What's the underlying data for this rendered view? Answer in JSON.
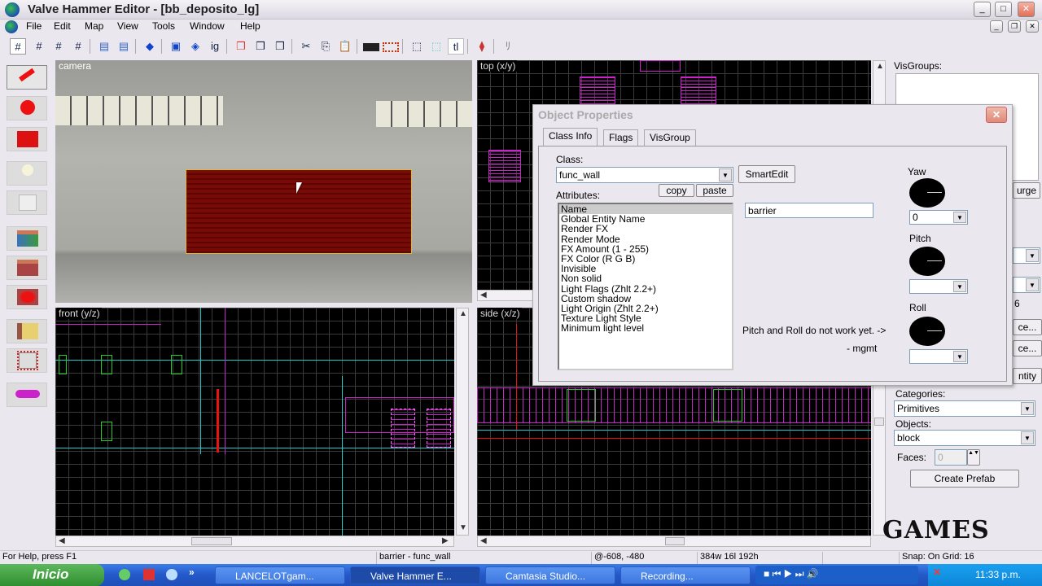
{
  "window": {
    "title": "Valve Hammer Editor - [bb_deposito_lg]",
    "min": "_",
    "max": "□",
    "close": "✕"
  },
  "menu": [
    "File",
    "Edit",
    "Map",
    "View",
    "Tools",
    "Window",
    "Help"
  ],
  "toolbar": {
    "ig_label": "ig",
    "tl_label": "tl"
  },
  "viewports": {
    "camera": "camera",
    "top": "top (x/y)",
    "front": "front (y/z)",
    "side": "side (x/z)"
  },
  "right_panel": {
    "visgroups_label": "VisGroups:",
    "purge_btn": "urge",
    "val6": "6",
    "btn_replace": "ce...",
    "btn_replace2": "ce...",
    "btn_entity": "ntity",
    "categories_label": "Categories:",
    "categories_value": "Primitives",
    "objects_label": "Objects:",
    "objects_value": "block",
    "faces_label": "Faces:",
    "faces_value": "0",
    "create_prefab": "Create Prefab"
  },
  "dialog": {
    "title": "Object Properties",
    "tabs": [
      "Class Info",
      "Flags",
      "VisGroup"
    ],
    "class_label": "Class:",
    "class_value": "func_wall",
    "smartedit": "SmartEdit",
    "attributes_label": "Attributes:",
    "copy": "copy",
    "paste": "paste",
    "attributes": [
      "Name",
      "Global Entity Name",
      "Render FX",
      "Render Mode",
      "FX Amount (1 - 255)",
      "FX Color (R G B)",
      "Invisible",
      "Non solid",
      "Light Flags (Zhlt 2.2+)",
      "Custom shadow",
      "Light Origin (Zhlt 2.2+)",
      "Texture Light Style",
      "Minimum light level"
    ],
    "value": "barrier",
    "yaw_label": "Yaw",
    "yaw_value": "0",
    "pitch_label": "Pitch",
    "pitch_value": "",
    "roll_label": "Roll",
    "roll_value": "",
    "note": "Pitch and Roll do not work yet. ->",
    "note_sig": "- mgmt"
  },
  "status": {
    "help": "For Help, press F1",
    "selection": "barrier - func_wall",
    "coords": "@-608, -480",
    "size": "384w 16l 192h",
    "snap": "Snap: On Grid: 16"
  },
  "taskbar": {
    "start": "Inicio",
    "tasks": [
      "LANCELOTgam...",
      "Valve Hammer E...",
      "Camtasia Studio...",
      "Recording..."
    ],
    "clock": "11:33 p.m.",
    "more": "»"
  },
  "watermark": "GAMES"
}
